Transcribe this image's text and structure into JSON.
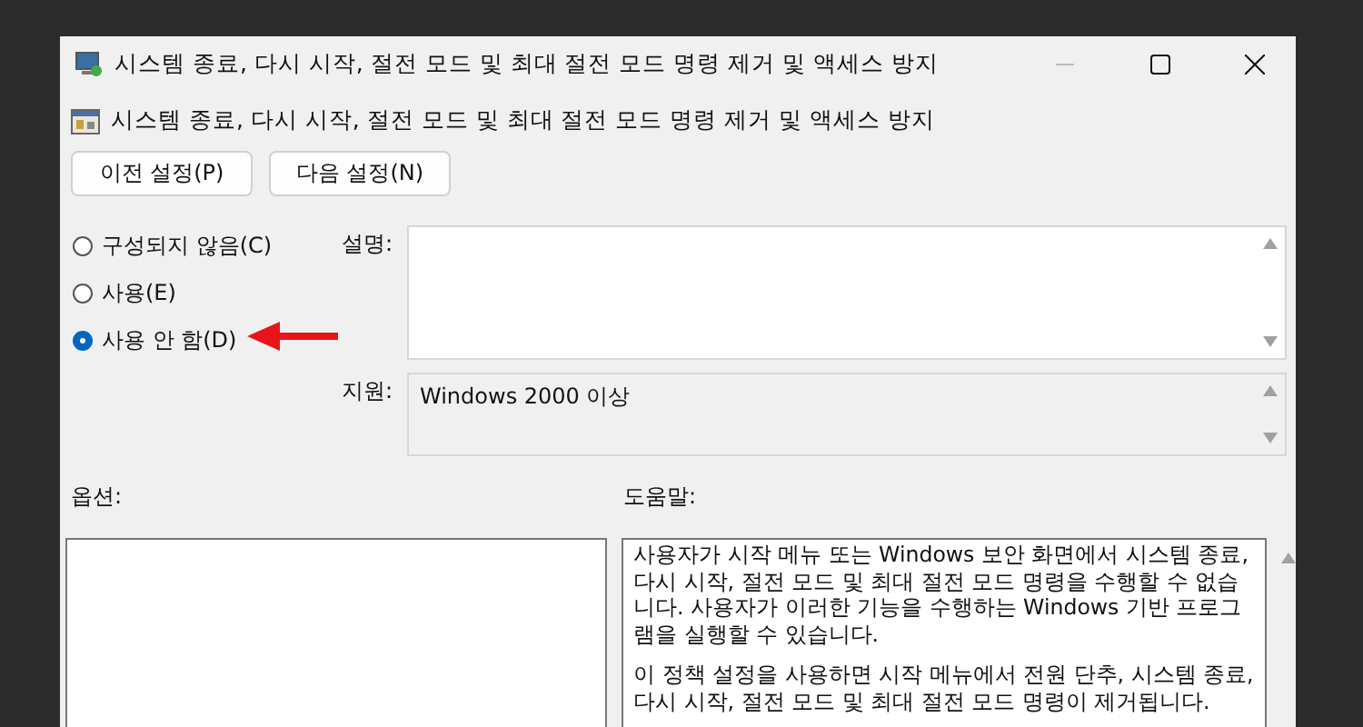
{
  "window": {
    "title": "시스템 종료, 다시 시작, 절전 모드 및 최대 절전 모드 명령 제거 및 액세스 방지"
  },
  "header": {
    "title": "시스템 종료, 다시 시작, 절전 모드 및 최대 절전 모드 명령 제거 및 액세스 방지"
  },
  "nav_buttons": [
    "이전 설정(P)",
    "다음 설정(N)"
  ],
  "options": [
    {
      "label": "구성되지 않음(C)",
      "selected": false
    },
    {
      "label": "사용(E)",
      "selected": false
    },
    {
      "label": "사용 안 함(D)",
      "selected": true
    }
  ],
  "description": {
    "label": "설명:"
  },
  "support": {
    "label": "지원:",
    "value": "Windows 2000 이상"
  },
  "options_panel": {
    "label": "옵션:"
  },
  "help": {
    "label": "도움말:",
    "paragraphs": [
      "사용자가 시작 메뉴 또는 Windows 보안 화면에서 시스템 종료, 다시 시작, 절전 모드 및 최대 절전 모드 명령을 수행할 수 없습니다. 사용자가 이러한 기능을 수행하는 Windows 기반 프로그램을 실행할 수 있습니다.",
      "이 정책 설정을 사용하면 시작 메뉴에서 전원 단추, 시스템 종료, 다시 시작, 절전 모드 및 최대 절전 모드 명령이 제거됩니다."
    ]
  }
}
